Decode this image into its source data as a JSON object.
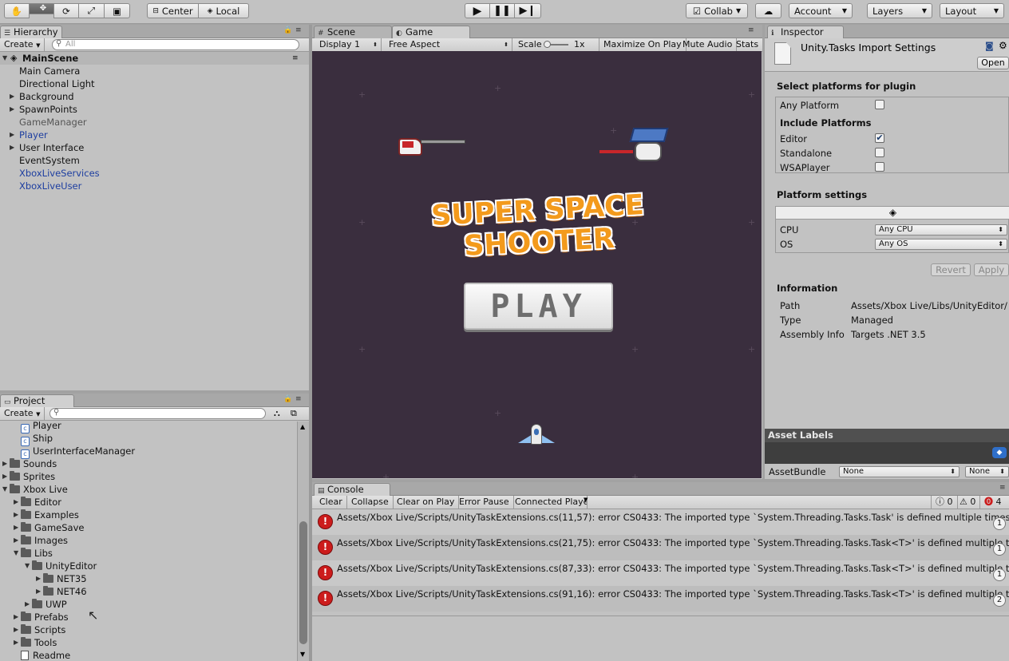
{
  "toolbar": {
    "center_label": "Center",
    "local_label": "Local",
    "collab_label": "Collab",
    "account_label": "Account",
    "layers_label": "Layers",
    "layout_label": "Layout"
  },
  "hierarchy": {
    "tab_label": "Hierarchy",
    "create_label": "Create",
    "search_placeholder": "All",
    "scene_name": "MainScene",
    "items": [
      {
        "label": "Main Camera",
        "style": "normal",
        "expandable": false
      },
      {
        "label": "Directional Light",
        "style": "normal",
        "expandable": false
      },
      {
        "label": "Background",
        "style": "normal",
        "expandable": true
      },
      {
        "label": "SpawnPoints",
        "style": "normal",
        "expandable": true
      },
      {
        "label": "GameManager",
        "style": "gray",
        "expandable": false
      },
      {
        "label": "Player",
        "style": "blue",
        "expandable": true
      },
      {
        "label": "User Interface",
        "style": "normal",
        "expandable": true
      },
      {
        "label": "EventSystem",
        "style": "normal",
        "expandable": false
      },
      {
        "label": "XboxLiveServices",
        "style": "blue",
        "expandable": false
      },
      {
        "label": "XboxLiveUser",
        "style": "blue",
        "expandable": false
      }
    ]
  },
  "project": {
    "tab_label": "Project",
    "create_label": "Create",
    "items": [
      {
        "label": "Player",
        "type": "script",
        "indent": 0
      },
      {
        "label": "Ship",
        "type": "script",
        "indent": 0
      },
      {
        "label": "UserInterfaceManager",
        "type": "script",
        "indent": 0
      },
      {
        "label": "Sounds",
        "type": "folder",
        "indent": 0,
        "arrow": "closed"
      },
      {
        "label": "Sprites",
        "type": "folder",
        "indent": 0,
        "arrow": "closed"
      },
      {
        "label": "Xbox Live",
        "type": "folder",
        "indent": 0,
        "arrow": "open"
      },
      {
        "label": "Editor",
        "type": "folder",
        "indent": 1,
        "arrow": "closed"
      },
      {
        "label": "Examples",
        "type": "folder",
        "indent": 1,
        "arrow": "closed"
      },
      {
        "label": "GameSave",
        "type": "folder",
        "indent": 1,
        "arrow": "closed"
      },
      {
        "label": "Images",
        "type": "folder",
        "indent": 1,
        "arrow": "closed"
      },
      {
        "label": "Libs",
        "type": "folder",
        "indent": 1,
        "arrow": "open"
      },
      {
        "label": "UnityEditor",
        "type": "folder",
        "indent": 2,
        "arrow": "open"
      },
      {
        "label": "NET35",
        "type": "folder",
        "indent": 3,
        "arrow": "closed"
      },
      {
        "label": "NET46",
        "type": "folder",
        "indent": 3,
        "arrow": "closed"
      },
      {
        "label": "UWP",
        "type": "folder",
        "indent": 2,
        "arrow": "closed"
      },
      {
        "label": "Prefabs",
        "type": "folder",
        "indent": 1,
        "arrow": "closed"
      },
      {
        "label": "Scripts",
        "type": "folder",
        "indent": 1,
        "arrow": "closed"
      },
      {
        "label": "Tools",
        "type": "folder",
        "indent": 1,
        "arrow": "closed"
      },
      {
        "label": "Readme",
        "type": "doc",
        "indent": 1
      }
    ]
  },
  "scene_tab": {
    "label": "Scene"
  },
  "game": {
    "tab_label": "Game",
    "display_label": "Display 1",
    "aspect_label": "Free Aspect",
    "scale_label": "Scale",
    "scale_value": "1x",
    "maximize_label": "Maximize On Play",
    "mute_label": "Mute Audio",
    "stats_label": "Stats",
    "title_text": "SUPER SPACE SHOOTER",
    "play_text": "PLAY"
  },
  "inspector": {
    "tab_label": "Inspector",
    "asset_title": "Unity.Tasks Import Settings",
    "open_label": "Open",
    "select_platforms_heading": "Select platforms for plugin",
    "any_platform_label": "Any Platform",
    "any_platform_checked": false,
    "include_platforms_heading": "Include Platforms",
    "platforms": [
      {
        "label": "Editor",
        "checked": true
      },
      {
        "label": "Standalone",
        "checked": false
      },
      {
        "label": "WSAPlayer",
        "checked": false
      }
    ],
    "platform_settings_heading": "Platform settings",
    "cpu_label": "CPU",
    "cpu_value": "Any CPU",
    "os_label": "OS",
    "os_value": "Any OS",
    "revert_label": "Revert",
    "apply_label": "Apply",
    "information_heading": "Information",
    "info": [
      {
        "key": "Path",
        "value": "Assets/Xbox Live/Libs/UnityEditor/"
      },
      {
        "key": "Type",
        "value": "Managed"
      },
      {
        "key": "Assembly Info",
        "value": "Targets .NET 3.5"
      }
    ],
    "asset_labels_heading": "Asset Labels",
    "assetbundle_label": "AssetBundle",
    "assetbundle_value": "None",
    "assetbundle_variant": "None"
  },
  "console": {
    "tab_label": "Console",
    "clear_label": "Clear",
    "collapse_label": "Collapse",
    "clear_on_play_label": "Clear on Play",
    "error_pause_label": "Error Pause",
    "connected_player_label": "Connected Player",
    "log_count": "0",
    "warning_count": "0",
    "error_count": "4",
    "errors": [
      {
        "text": "Assets/Xbox Live/Scripts/UnityTaskExtensions.cs(11,57): error CS0433: The imported type `System.Threading.Tasks.Task' is defined multiple times",
        "count": "1"
      },
      {
        "text": "Assets/Xbox Live/Scripts/UnityTaskExtensions.cs(21,75): error CS0433: The imported type `System.Threading.Tasks.Task<T>' is defined multiple times",
        "count": "1"
      },
      {
        "text": "Assets/Xbox Live/Scripts/UnityTaskExtensions.cs(87,33): error CS0433: The imported type `System.Threading.Tasks.Task<T>' is defined multiple times",
        "count": "1"
      },
      {
        "text": "Assets/Xbox Live/Scripts/UnityTaskExtensions.cs(91,16): error CS0433: The imported type `System.Threading.Tasks.Task<T>' is defined multiple times",
        "count": "2"
      }
    ]
  },
  "colors": {
    "game_background": "#3a2e3e",
    "title_orange": "#f39a1c",
    "error_red": "#cc1c1c",
    "link_blue": "#1d3ea0"
  }
}
